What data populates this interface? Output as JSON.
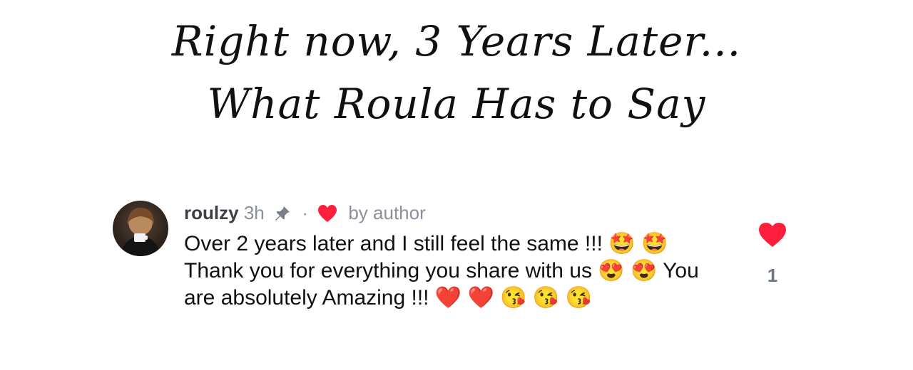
{
  "heading": {
    "line1": "Right now, 3 Years Later...",
    "line2": "What Roula Has to Say"
  },
  "comment": {
    "username": "roulzy",
    "time": "3h",
    "separator": "·",
    "liked_by_author": "by author",
    "text": "Over 2 years later and I still feel the same !!! 🤩 🤩 Thank you for everything you share with us 😍 😍 You are absolutely Amazing !!! ❤️ ❤️ 😘 😘 😘",
    "like_count": "1",
    "icons": [
      "pin-icon",
      "heart-icon",
      "avatar"
    ],
    "heart_color": "#ff1f3d"
  }
}
